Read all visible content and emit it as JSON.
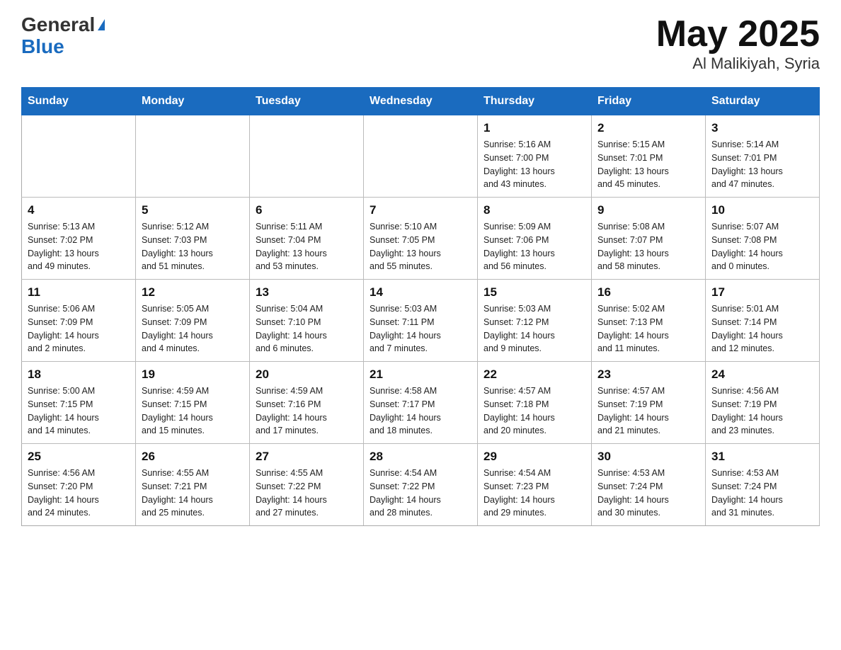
{
  "header": {
    "logo_line1": "General",
    "logo_line2": "Blue",
    "title": "May 2025",
    "subtitle": "Al Malikiyah, Syria"
  },
  "weekdays": [
    "Sunday",
    "Monday",
    "Tuesday",
    "Wednesday",
    "Thursday",
    "Friday",
    "Saturday"
  ],
  "weeks": [
    [
      {
        "day": "",
        "info": ""
      },
      {
        "day": "",
        "info": ""
      },
      {
        "day": "",
        "info": ""
      },
      {
        "day": "",
        "info": ""
      },
      {
        "day": "1",
        "info": "Sunrise: 5:16 AM\nSunset: 7:00 PM\nDaylight: 13 hours\nand 43 minutes."
      },
      {
        "day": "2",
        "info": "Sunrise: 5:15 AM\nSunset: 7:01 PM\nDaylight: 13 hours\nand 45 minutes."
      },
      {
        "day": "3",
        "info": "Sunrise: 5:14 AM\nSunset: 7:01 PM\nDaylight: 13 hours\nand 47 minutes."
      }
    ],
    [
      {
        "day": "4",
        "info": "Sunrise: 5:13 AM\nSunset: 7:02 PM\nDaylight: 13 hours\nand 49 minutes."
      },
      {
        "day": "5",
        "info": "Sunrise: 5:12 AM\nSunset: 7:03 PM\nDaylight: 13 hours\nand 51 minutes."
      },
      {
        "day": "6",
        "info": "Sunrise: 5:11 AM\nSunset: 7:04 PM\nDaylight: 13 hours\nand 53 minutes."
      },
      {
        "day": "7",
        "info": "Sunrise: 5:10 AM\nSunset: 7:05 PM\nDaylight: 13 hours\nand 55 minutes."
      },
      {
        "day": "8",
        "info": "Sunrise: 5:09 AM\nSunset: 7:06 PM\nDaylight: 13 hours\nand 56 minutes."
      },
      {
        "day": "9",
        "info": "Sunrise: 5:08 AM\nSunset: 7:07 PM\nDaylight: 13 hours\nand 58 minutes."
      },
      {
        "day": "10",
        "info": "Sunrise: 5:07 AM\nSunset: 7:08 PM\nDaylight: 14 hours\nand 0 minutes."
      }
    ],
    [
      {
        "day": "11",
        "info": "Sunrise: 5:06 AM\nSunset: 7:09 PM\nDaylight: 14 hours\nand 2 minutes."
      },
      {
        "day": "12",
        "info": "Sunrise: 5:05 AM\nSunset: 7:09 PM\nDaylight: 14 hours\nand 4 minutes."
      },
      {
        "day": "13",
        "info": "Sunrise: 5:04 AM\nSunset: 7:10 PM\nDaylight: 14 hours\nand 6 minutes."
      },
      {
        "day": "14",
        "info": "Sunrise: 5:03 AM\nSunset: 7:11 PM\nDaylight: 14 hours\nand 7 minutes."
      },
      {
        "day": "15",
        "info": "Sunrise: 5:03 AM\nSunset: 7:12 PM\nDaylight: 14 hours\nand 9 minutes."
      },
      {
        "day": "16",
        "info": "Sunrise: 5:02 AM\nSunset: 7:13 PM\nDaylight: 14 hours\nand 11 minutes."
      },
      {
        "day": "17",
        "info": "Sunrise: 5:01 AM\nSunset: 7:14 PM\nDaylight: 14 hours\nand 12 minutes."
      }
    ],
    [
      {
        "day": "18",
        "info": "Sunrise: 5:00 AM\nSunset: 7:15 PM\nDaylight: 14 hours\nand 14 minutes."
      },
      {
        "day": "19",
        "info": "Sunrise: 4:59 AM\nSunset: 7:15 PM\nDaylight: 14 hours\nand 15 minutes."
      },
      {
        "day": "20",
        "info": "Sunrise: 4:59 AM\nSunset: 7:16 PM\nDaylight: 14 hours\nand 17 minutes."
      },
      {
        "day": "21",
        "info": "Sunrise: 4:58 AM\nSunset: 7:17 PM\nDaylight: 14 hours\nand 18 minutes."
      },
      {
        "day": "22",
        "info": "Sunrise: 4:57 AM\nSunset: 7:18 PM\nDaylight: 14 hours\nand 20 minutes."
      },
      {
        "day": "23",
        "info": "Sunrise: 4:57 AM\nSunset: 7:19 PM\nDaylight: 14 hours\nand 21 minutes."
      },
      {
        "day": "24",
        "info": "Sunrise: 4:56 AM\nSunset: 7:19 PM\nDaylight: 14 hours\nand 23 minutes."
      }
    ],
    [
      {
        "day": "25",
        "info": "Sunrise: 4:56 AM\nSunset: 7:20 PM\nDaylight: 14 hours\nand 24 minutes."
      },
      {
        "day": "26",
        "info": "Sunrise: 4:55 AM\nSunset: 7:21 PM\nDaylight: 14 hours\nand 25 minutes."
      },
      {
        "day": "27",
        "info": "Sunrise: 4:55 AM\nSunset: 7:22 PM\nDaylight: 14 hours\nand 27 minutes."
      },
      {
        "day": "28",
        "info": "Sunrise: 4:54 AM\nSunset: 7:22 PM\nDaylight: 14 hours\nand 28 minutes."
      },
      {
        "day": "29",
        "info": "Sunrise: 4:54 AM\nSunset: 7:23 PM\nDaylight: 14 hours\nand 29 minutes."
      },
      {
        "day": "30",
        "info": "Sunrise: 4:53 AM\nSunset: 7:24 PM\nDaylight: 14 hours\nand 30 minutes."
      },
      {
        "day": "31",
        "info": "Sunrise: 4:53 AM\nSunset: 7:24 PM\nDaylight: 14 hours\nand 31 minutes."
      }
    ]
  ]
}
